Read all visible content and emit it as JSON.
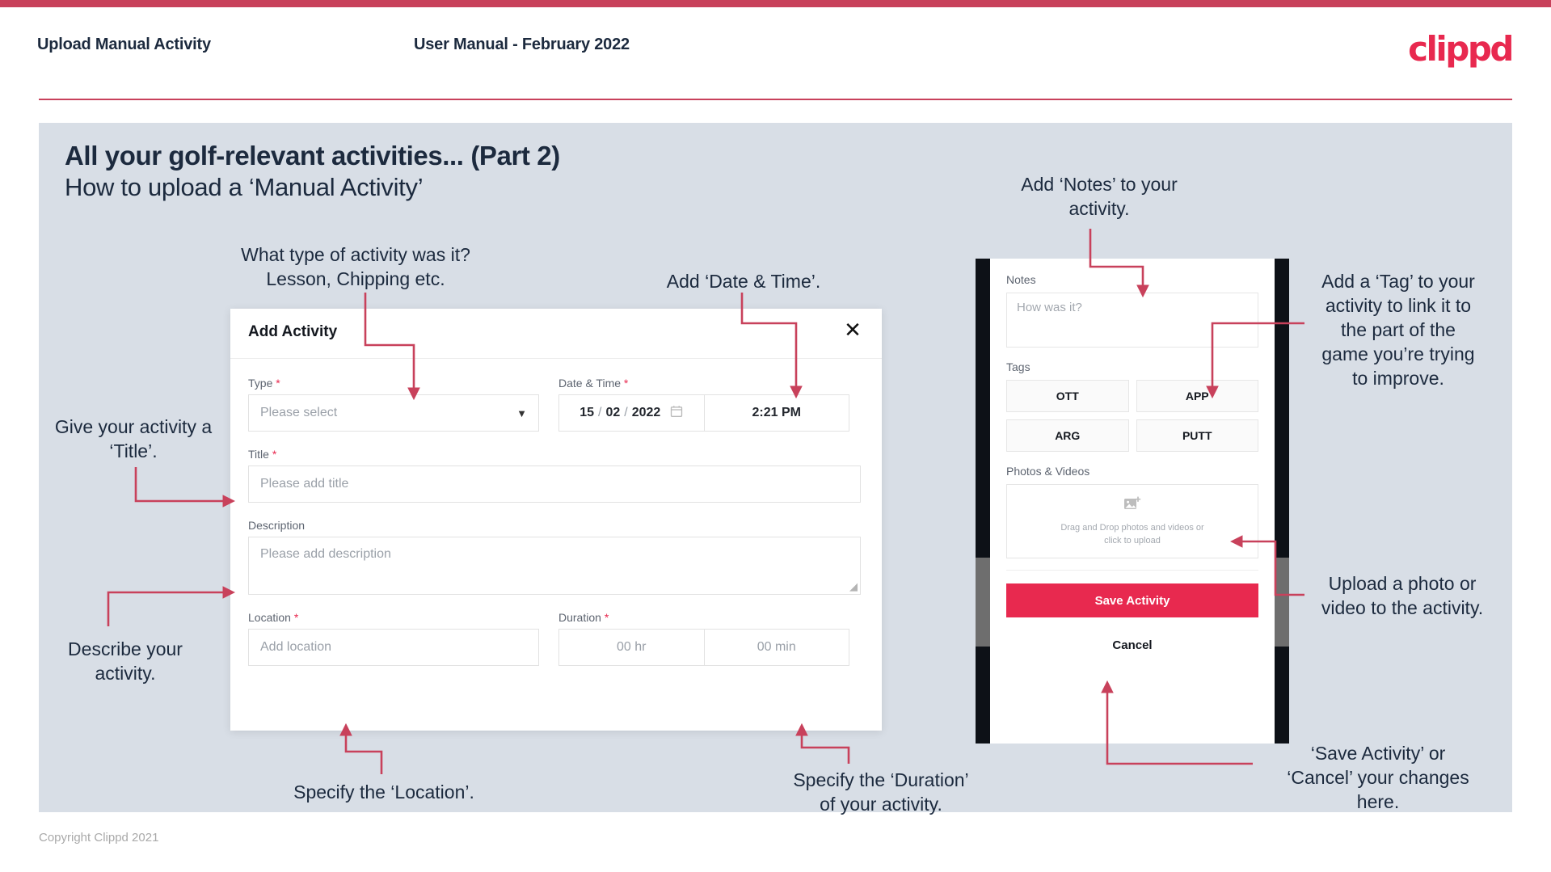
{
  "header": {
    "title": "Upload Manual Activity",
    "subtitle": "User Manual - February 2022",
    "logo": "clippd"
  },
  "slide": {
    "title": "All your golf-relevant activities... (Part 2)",
    "subtitle": "How to upload a ‘Manual Activity’"
  },
  "annotations": {
    "type": "What type of activity was it?\nLesson, Chipping etc.",
    "datetime": "Add ‘Date & Time’.",
    "title": "Give your activity a\n‘Title’.",
    "description": "Describe your\nactivity.",
    "location": "Specify the ‘Location’.",
    "duration": "Specify the ‘Duration’\nof your activity.",
    "notes": "Add ‘Notes’ to your\nactivity.",
    "tags": "Add a ‘Tag’ to your\nactivity to link it to\nthe part of the\ngame you’re trying\nto improve.",
    "photos": "Upload a photo or\nvideo to the activity.",
    "save": "‘Save Activity’ or\n‘Cancel’ your changes\nhere."
  },
  "dialog": {
    "title": "Add Activity",
    "close_icon": "close-icon",
    "fields": {
      "type": {
        "label": "Type",
        "required": "*",
        "value": "Please select",
        "chevron": "chevron-down-icon"
      },
      "datetime": {
        "label": "Date & Time",
        "required": "*",
        "day": "15",
        "sep1": "/",
        "month": "02",
        "sep2": "/",
        "year": "2022",
        "calendar_icon": "calendar-icon",
        "time": "2:21 PM"
      },
      "title": {
        "label": "Title",
        "required": "*",
        "placeholder": "Please add title"
      },
      "description": {
        "label": "Description",
        "placeholder": "Please add description"
      },
      "location": {
        "label": "Location",
        "required": "*",
        "placeholder": "Add location"
      },
      "duration": {
        "label": "Duration",
        "required": "*",
        "hours": "00 hr",
        "minutes": "00 min"
      }
    }
  },
  "phone": {
    "notes": {
      "label": "Notes",
      "placeholder": "How was it?"
    },
    "tags": {
      "label": "Tags",
      "items": [
        "OTT",
        "APP",
        "ARG",
        "PUTT"
      ]
    },
    "photos": {
      "label": "Photos & Videos",
      "icon": "add-image-icon",
      "hint_line1": "Drag and Drop photos and videos or",
      "hint_line2": "click to upload"
    },
    "save_label": "Save Activity",
    "cancel_label": "Cancel"
  },
  "footer": "Copyright Clippd 2021",
  "colors": {
    "accent": "#e8294f",
    "rule": "#c8415b",
    "canvas": "#d8dee6",
    "ink": "#1c2a3e"
  }
}
